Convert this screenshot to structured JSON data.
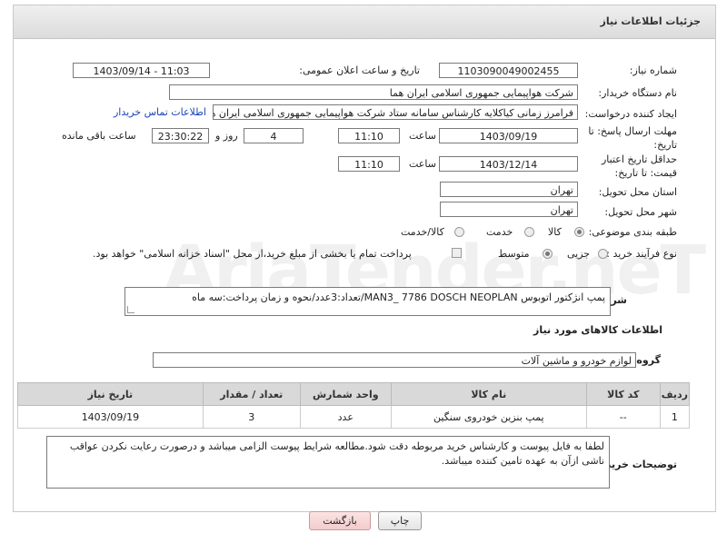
{
  "header": {
    "title": "جزئیات اطلاعات نیاز"
  },
  "fields": {
    "need_number_label": "شماره نیاز:",
    "need_number": "1103090049002455",
    "announce_label": "تاریخ و ساعت اعلان عمومی:",
    "announce_value": "1403/09/14 - 11:03",
    "buyer_org_label": "نام دستگاه خریدار:",
    "buyer_org": "شرکت هواپیمایی جمهوری اسلامی ایران هما",
    "creator_label": "ایجاد کننده درخواست:",
    "creator": "فرامرز زمانی کیاکلایه کارشناس سامانه ستاد شرکت هواپیمایی جمهوری اسلامی ایران هما",
    "buyer_contact_link": "اطلاعات تماس خریدار",
    "deadline_label": "مهلت ارسال پاسخ: تا تاریخ:",
    "deadline_date": "1403/09/19",
    "time_label": "ساعت",
    "deadline_time": "11:10",
    "days_value": "4",
    "days_label": "روز و",
    "remaining_time": "23:30:22",
    "remaining_label": "ساعت باقی مانده",
    "price_valid_label": "حداقل تاریخ اعتبار قیمت: تا تاریخ:",
    "price_valid_date": "1403/12/14",
    "price_valid_time": "11:10",
    "province_label": "استان محل تحویل:",
    "province": "تهران",
    "city_label": "شهر محل تحویل:",
    "city": "تهران",
    "category_label": "طبقه بندی موضوعی:",
    "category_options": [
      "کالا",
      "خدمت",
      "کالا/خدمت"
    ],
    "process_label": "نوع فرآیند خرید :",
    "process_options": [
      "جزیی",
      "متوسط"
    ],
    "payment_note": "پرداخت تمام یا بخشی از مبلغ خرید،از محل \"اسناد خزانه اسلامی\" خواهد بود.",
    "summary_label": "شرح کلی نیاز:",
    "summary": "پمپ انژکتور اتوبوس MAN3_ 7786 DOSCH NEOPLAN/تعداد:3عدد/نحوه و زمان پرداخت:سه ماه",
    "goods_info_title": "اطلاعات کالاهای مورد نیاز",
    "goods_group_label": "گروه کالا:",
    "goods_group": "لوازم خودرو و ماشین آلات"
  },
  "table": {
    "headers": [
      "ردیف",
      "کد کالا",
      "نام کالا",
      "واحد شمارش",
      "تعداد / مقدار",
      "تاریخ نیاز"
    ],
    "rows": [
      [
        "1",
        "--",
        "پمپ بنزین خودروی سنگین",
        "عدد",
        "3",
        "1403/09/19"
      ]
    ]
  },
  "buyer_notes_label": "توضیحات خریدار:",
  "buyer_notes": "لطفا به فایل پیوست و کارشناس خرید مربوطه دقت شود.مطالعه شرایط پیوست الزامی میباشد و درصورت رعایت نکردن عواقب ناشی ازآن به عهده تامین کننده میباشد.",
  "buttons": {
    "print": "چاپ",
    "back": "بازگشت"
  },
  "watermark": "AriaTender.neT"
}
